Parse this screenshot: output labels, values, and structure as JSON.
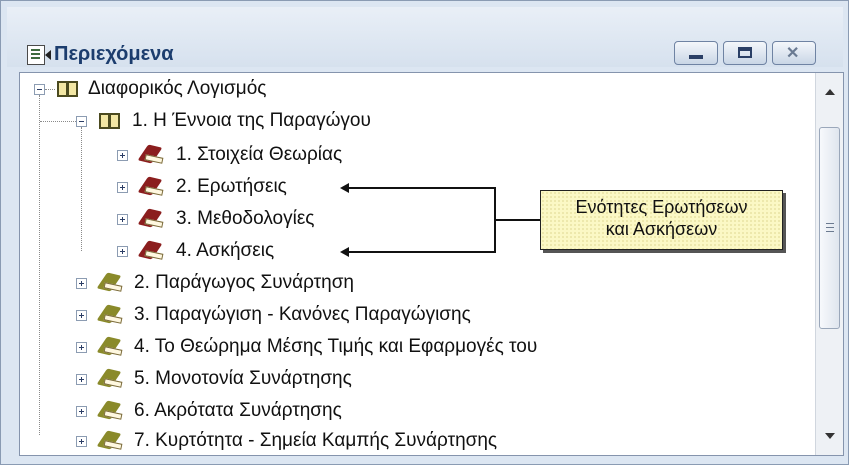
{
  "window": {
    "title": "Περιεχόμενα",
    "icon": "contents-icon",
    "buttons": {
      "minimize": "minimize-icon",
      "maximize": "maximize-icon",
      "close": "close-icon"
    }
  },
  "tree": {
    "root": {
      "label": "Διαφορικός Λογισμός",
      "expanded": true
    },
    "chapter1": {
      "label": "1.  Η Έννοια της Παραγώγου",
      "expanded": true
    },
    "sections": [
      {
        "label": "1.  Στοιχεία Θεωρίας"
      },
      {
        "label": "2.  Ερωτήσεις"
      },
      {
        "label": "3.  Μεθοδολογίες"
      },
      {
        "label": "4.  Ασκήσεις"
      }
    ],
    "chapters": [
      {
        "label": "2.  Παράγωγος Συνάρτηση"
      },
      {
        "label": "3.  Παραγώγιση - Κανόνες Παραγώγισης"
      },
      {
        "label": "4.  Το Θεώρημα Μέσης Τιμής και Εφαρμογές του"
      },
      {
        "label": "5.  Μονοτονία Συνάρτησης"
      },
      {
        "label": "6.  Ακρότατα Συνάρτησης"
      },
      {
        "label": "7.  Κυρτότητα - Σημεία Καμπής Συνάρτησης"
      }
    ]
  },
  "callout": {
    "line1": "Ενότητες Ερωτήσεων",
    "line2": "και Ασκήσεων"
  },
  "colors": {
    "section_book": "#8b1e1e",
    "chapter_book": "#8a8a2a",
    "callout_bg": "#fbf8c5"
  }
}
